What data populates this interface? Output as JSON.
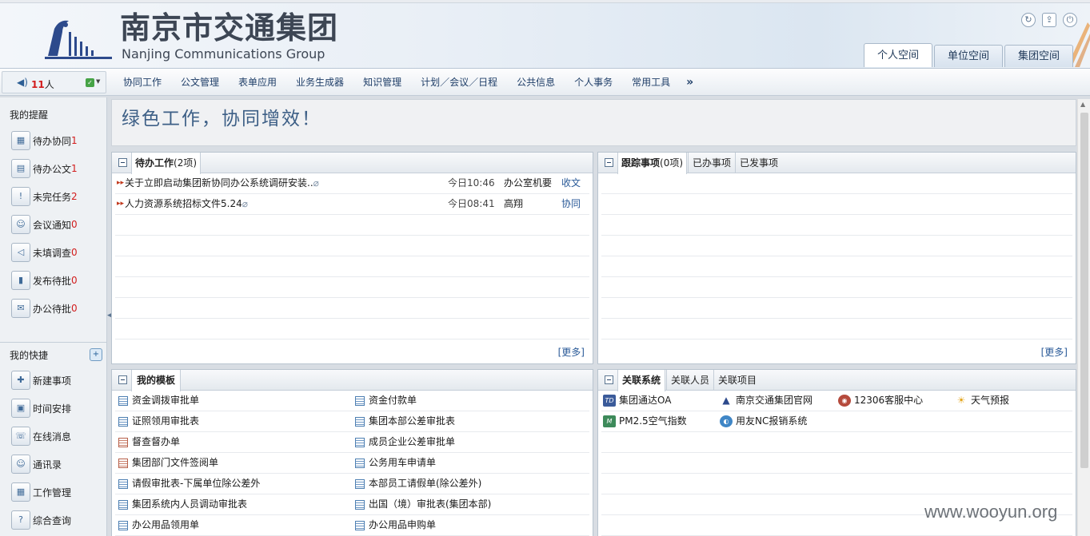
{
  "header": {
    "brand_cn": "南京市交通集团",
    "brand_en": "Nanjing Communications Group",
    "space_tabs": [
      {
        "label": "个人空间",
        "active": true
      },
      {
        "label": "单位空间",
        "active": false
      },
      {
        "label": "集团空间",
        "active": false
      }
    ]
  },
  "status": {
    "count": "11",
    "suffix": "人"
  },
  "nav": {
    "items": [
      "协同工作",
      "公文管理",
      "表单应用",
      "业务生成器",
      "知识管理",
      "计划／会议／日程",
      "公共信息",
      "个人事务",
      "常用工具"
    ],
    "more": "»"
  },
  "sidebar": {
    "reminders_title": "我的提醒",
    "reminders": [
      {
        "label": "待办协同",
        "count": "1"
      },
      {
        "label": "待办公文",
        "count": "1"
      },
      {
        "label": "未完任务",
        "count": "2"
      },
      {
        "label": "会议通知",
        "count": "0"
      },
      {
        "label": "未填调查",
        "count": "0"
      },
      {
        "label": "发布待批",
        "count": "0"
      },
      {
        "label": "办公待批",
        "count": "0"
      }
    ],
    "shortcuts_title": "我的快捷",
    "shortcuts": [
      "新建事项",
      "时间安排",
      "在线消息",
      "通讯录",
      "工作管理",
      "综合查询"
    ]
  },
  "banner": "绿色工作，协同增效！",
  "todo": {
    "title": "待办工作",
    "count": "(2项)",
    "rows": [
      {
        "title": "关于立即启动集团新协同办公系统调研安装..",
        "time": "今日10:46",
        "person": "办公室机要",
        "type": "收文"
      },
      {
        "title": "人力资源系统招标文件5.24",
        "time": "今日08:41",
        "person": "高翔",
        "type": "协同"
      }
    ],
    "more": "[更多]"
  },
  "tracking": {
    "tabs": [
      {
        "label": "跟踪事项",
        "count": "(0项)"
      },
      {
        "label": "已办事项"
      },
      {
        "label": "已发事项"
      }
    ],
    "more": "[更多]"
  },
  "templates": {
    "title": "我的模板",
    "items": [
      [
        "资金调拨审批单",
        "资金付款单"
      ],
      [
        "证照领用审批表",
        "集团本部公差审批表"
      ],
      [
        "督查督办单",
        "成员企业公差审批单"
      ],
      [
        "集团部门文件签阅单",
        "公务用车申请单"
      ],
      [
        "请假审批表-下属单位除公差外",
        "本部员工请假单(除公差外)"
      ],
      [
        "集团系统内人员调动审批表",
        "出国（境）审批表(集团本部)"
      ],
      [
        "办公用品领用单",
        "办公用品申购单"
      ]
    ]
  },
  "related": {
    "tabs": [
      "关联系统",
      "关联人员",
      "关联项目"
    ],
    "rows": [
      [
        "集团通达OA",
        "南京交通集团官网",
        "12306客服中心",
        "天气预报"
      ],
      [
        "PM2.5空气指数",
        "用友NC报销系统"
      ]
    ]
  },
  "watermark": "www.wooyun.org"
}
